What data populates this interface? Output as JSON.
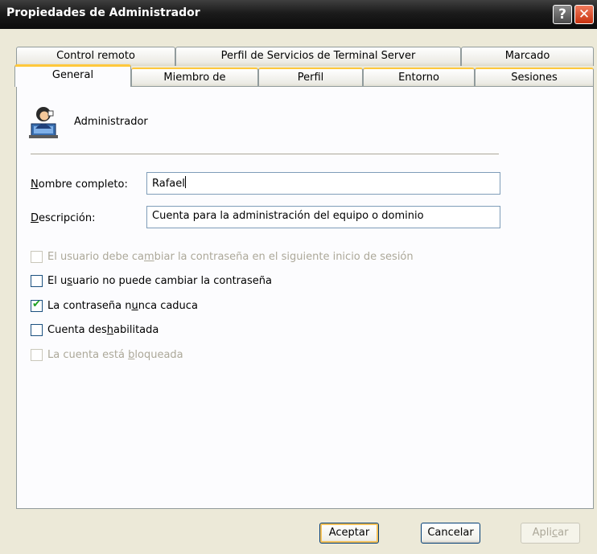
{
  "window": {
    "title": "Propiedades de Administrador",
    "help_label": "?",
    "close_label": "✕"
  },
  "tabs": {
    "row1": [
      "Control remoto",
      "Perfil de Servicios de Terminal Server",
      "Marcado"
    ],
    "row2": [
      "General",
      "Miembro de",
      "Perfil",
      "Entorno",
      "Sesiones"
    ],
    "active": "General"
  },
  "general": {
    "user_name": "Administrador",
    "full_name_label_prefix": "N",
    "full_name_label_rest": "ombre completo:",
    "full_name_value": "Rafael",
    "description_label_prefix": "D",
    "description_label_rest": "escripción:",
    "description_value": "Cuenta para la administración del equipo o dominio",
    "checkboxes": [
      {
        "pre": "El usuario debe ca",
        "u": "m",
        "post": "biar la contraseña en el siguiente inicio de sesión",
        "checked": false,
        "enabled": false
      },
      {
        "pre": "El u",
        "u": "s",
        "post": "uario no puede cambiar la contraseña",
        "checked": false,
        "enabled": true
      },
      {
        "pre": "La contraseña n",
        "u": "u",
        "post": "nca caduca",
        "checked": true,
        "enabled": true
      },
      {
        "pre": "Cuenta des",
        "u": "h",
        "post": "abilitada",
        "checked": false,
        "enabled": true
      },
      {
        "pre": "La cuenta está ",
        "u": "b",
        "post": "loqueada",
        "checked": false,
        "enabled": false
      }
    ]
  },
  "buttons": {
    "ok": "Aceptar",
    "cancel": "Cancelar",
    "apply_pre": "Apli",
    "apply_u": "c",
    "apply_post": "ar"
  },
  "colors": {
    "title_bar": "#1b1b1b",
    "tab_accent": "#ffc83c",
    "dialog_bg": "#ECE9D8",
    "check_mark": "#21a121"
  }
}
